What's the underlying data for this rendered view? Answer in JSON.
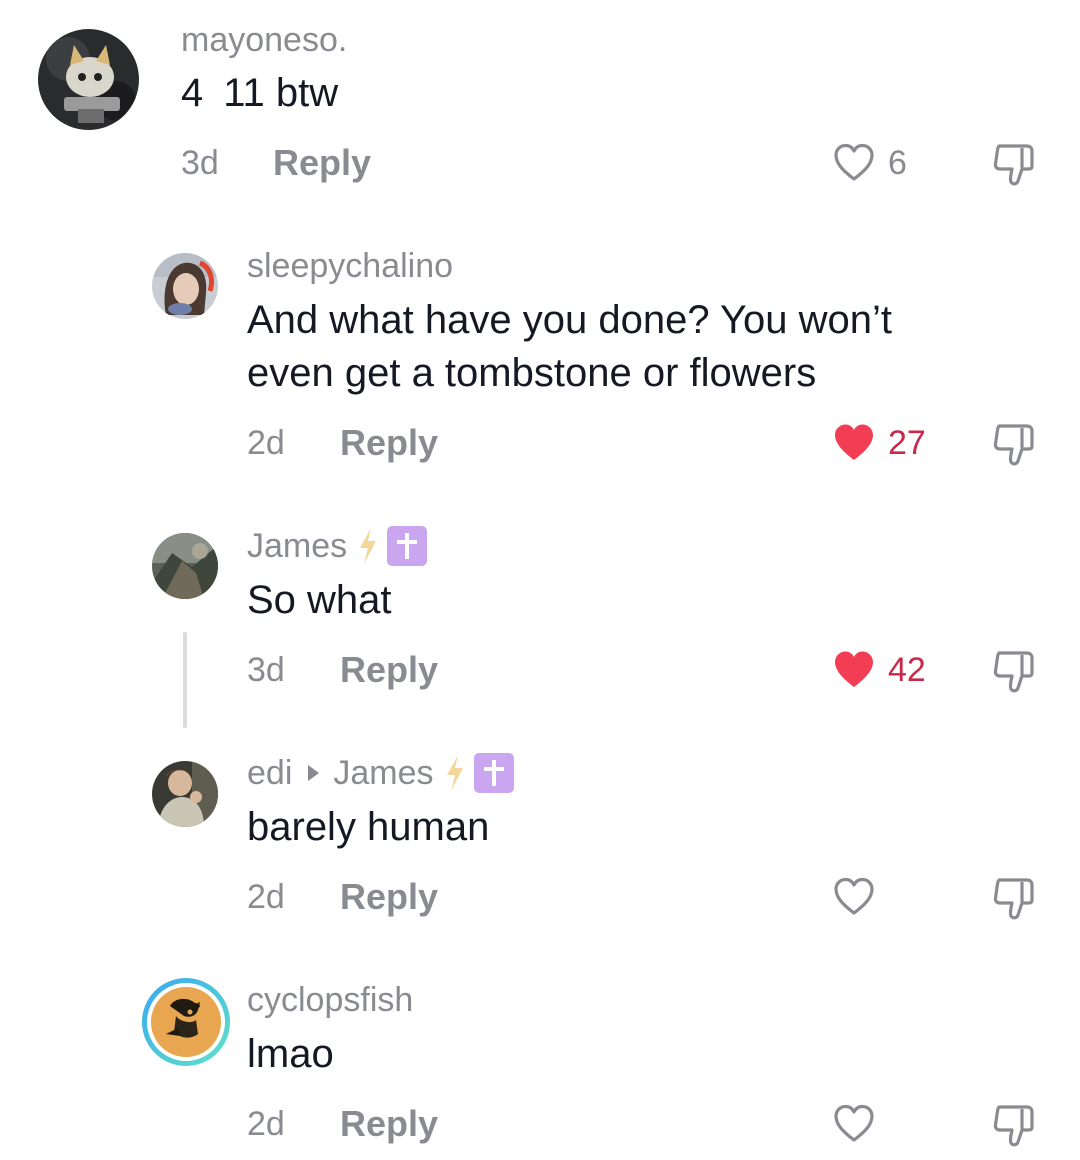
{
  "comments": [
    {
      "username": "mayoneso.",
      "text": "4 11 btw",
      "time": "3d",
      "reply_label": "Reply",
      "likes": "6",
      "liked": false
    },
    {
      "username": "sleepychalino",
      "text": "And what have you done? You won’t even get a tombstone or flowers",
      "time": "2d",
      "reply_label": "Reply",
      "likes": "27",
      "liked": true
    },
    {
      "username": "James",
      "badges": [
        "lightning-bolt",
        "latin-cross"
      ],
      "text": "So what",
      "time": "3d",
      "reply_label": "Reply",
      "likes": "42",
      "liked": true
    },
    {
      "username": "edi",
      "reply_to": "James",
      "badges": [
        "lightning-bolt",
        "latin-cross"
      ],
      "text": "barely human",
      "time": "2d",
      "reply_label": "Reply",
      "likes": "",
      "liked": false
    },
    {
      "username": "cyclopsfish",
      "text": "lmao",
      "time": "2d",
      "reply_label": "Reply",
      "likes": "",
      "liked": false
    }
  ],
  "colors": {
    "liked_heart": "#f23d55",
    "liked_count": "#c52a4a",
    "muted_text": "#8a8b91",
    "cross_badge": "#cba6f0",
    "bolt_badge": "#f3d79a"
  }
}
